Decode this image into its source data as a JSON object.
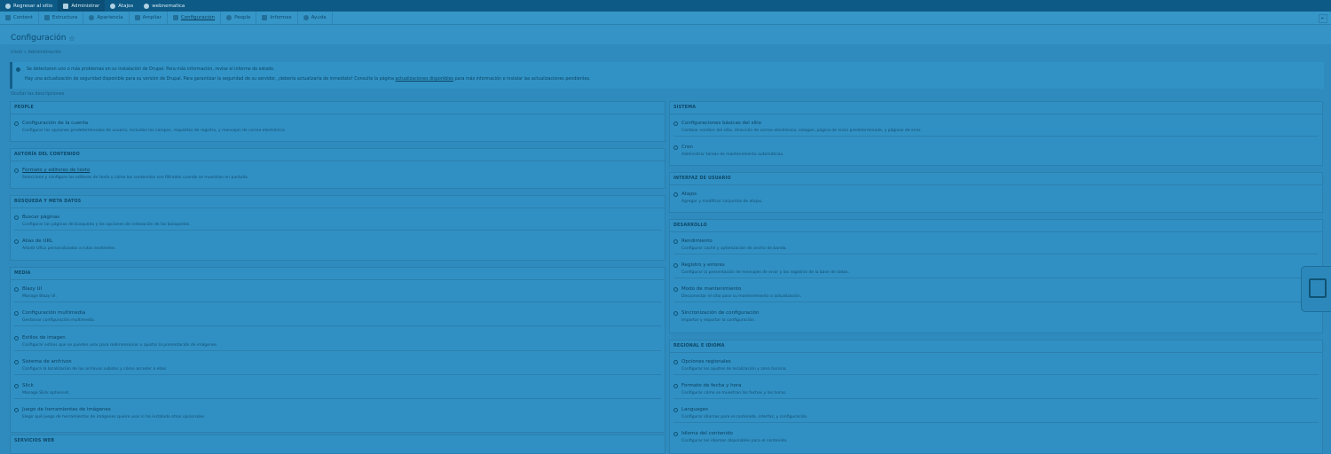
{
  "toolbar": {
    "back": "Regresar al sitio",
    "manage": "Administrar",
    "shortcuts": "Atajos",
    "user": "webnematica"
  },
  "tray": {
    "items": [
      "Content",
      "Estructura",
      "Apariencia",
      "Ampliar",
      "Configuración",
      "People",
      "Informes",
      "Ayuda"
    ]
  },
  "page": {
    "title": "Configuración",
    "breadcrumb": "Inicio » Administración",
    "hide_descriptions": "Ocultar las descripciones"
  },
  "alert": {
    "line1": "Se detectaron uno o más problemas en su instalación de Drupal. Para más información, revise el informe de estado.",
    "line2_pre": "Hay una actualización de seguridad disponible para su versión de Drupal. Para garantizar la seguridad de su servidor, ¡debería actualizarla de inmediato! Consulte la página ",
    "line2_link": "actualizaciones disponibles",
    "line2_post": " para más información e instalar las actualizaciones pendientes."
  },
  "left_panels": [
    {
      "title": "PEOPLE",
      "items": [
        {
          "title": "Configuración de la cuenta",
          "desc": "Configurar las opciones predeterminadas de usuario, incluidos los campos, requisitos de registro, y mensajes de correo electrónico."
        }
      ]
    },
    {
      "title": "AUTORÍA DEL CONTENIDO",
      "items": [
        {
          "title": "Formato y editores de texto",
          "desc": "Seleccione y configure los editores de texto y cómo los contenidos son filtrados cuando se muestran en pantalla."
        }
      ]
    },
    {
      "title": "BÚSQUEDA Y META DATOS",
      "items": [
        {
          "title": "Buscar páginas",
          "desc": "Configurar las páginas de búsqueda y las opciones de indexación de las búsquedas."
        },
        {
          "title": "Alias de URL",
          "desc": "Añadir URLs personalizadas a rutas existentes."
        }
      ]
    },
    {
      "title": "MEDIA",
      "items": [
        {
          "title": "Blazy UI",
          "desc": "Manage Blazy UI."
        },
        {
          "title": "Configuración multimedia",
          "desc": "Gestionar configuración multimedia."
        },
        {
          "title": "Estilos de imagen",
          "desc": "Configurar estilos que se pueden usar para redimensionar o ajustar la presentación de imágenes."
        },
        {
          "title": "Sistema de archivos",
          "desc": "Configura la localización de los archivos subidos y cómo acceder a ellos."
        },
        {
          "title": "Slick",
          "desc": "Manage Slick optionset."
        },
        {
          "title": "Juego de herramientas de imágenes",
          "desc": "Elegir qué juego de herramientas de imágenes quiere usar si ha instalado otros opcionales."
        }
      ]
    },
    {
      "title": "SERVICIOS WEB",
      "items": []
    }
  ],
  "right_panels": [
    {
      "title": "SISTEMA",
      "items": [
        {
          "title": "Configuraciones básicas del sitio",
          "desc": "Cambiar nombre del sitio, dirección de correo electrónico, eslogan, página de inicio predeterminada, y páginas de error."
        },
        {
          "title": "Cron",
          "desc": "Administrar tareas de mantenimiento automáticas."
        }
      ]
    },
    {
      "title": "INTERFAZ DE USUARIO",
      "items": [
        {
          "title": "Atajos",
          "desc": "Agregar y modificar conjuntos de atajos."
        }
      ]
    },
    {
      "title": "DESARROLLO",
      "items": [
        {
          "title": "Rendimiento",
          "desc": "Configurar caché y optimización de ancho de banda."
        },
        {
          "title": "Registro y errores",
          "desc": "Configurar la presentación de mensajes de error y los registros de la base de datos."
        },
        {
          "title": "Modo de mantenimiento",
          "desc": "Desconectar el sitio para su mantenimiento o actualización."
        },
        {
          "title": "Sincronización de configuración",
          "desc": "Importar y exportar la configuración."
        }
      ]
    },
    {
      "title": "REGIONAL E IDIOMA",
      "items": [
        {
          "title": "Opciones regionales",
          "desc": "Configurar los ajustes de localización y zona horaria."
        },
        {
          "title": "Formato de fecha y hora",
          "desc": "Configurar cómo se muestran las fechas y las horas."
        },
        {
          "title": "Languages",
          "desc": "Configurar idiomas para el contenido, interfaz, y configuración."
        },
        {
          "title": "Idioma del contenido",
          "desc": "Configurar los idiomas disponibles para el contenido."
        }
      ]
    }
  ]
}
